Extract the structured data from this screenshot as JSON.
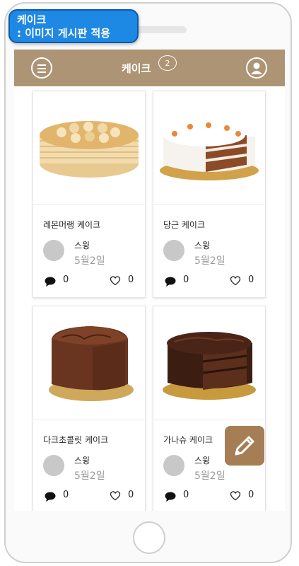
{
  "callout": {
    "line1": "케이크",
    "line2": ": 이미지 게시판 적용"
  },
  "header": {
    "title": "케이크",
    "badge": "2"
  },
  "posts": [
    {
      "title": "레몬머랭 케이크",
      "author": "스윙",
      "date": "5월2일",
      "comments": "0",
      "likes": "0"
    },
    {
      "title": "당근 케이크",
      "author": "스윙",
      "date": "5월2일",
      "comments": "0",
      "likes": "0"
    },
    {
      "title": "다크초콜릿 케이크",
      "author": "스윙",
      "date": "5월2일",
      "comments": "0",
      "likes": "0"
    },
    {
      "title": "가나슈 케이크",
      "author": "스윙",
      "date": "5월2일",
      "comments": "0",
      "likes": "0"
    }
  ],
  "icons": {
    "menu": "hamburger-icon",
    "profile": "user-icon",
    "comment": "speech-bubble-icon",
    "like": "heart-icon",
    "write": "pencil-icon"
  },
  "colors": {
    "header": "#ad9475",
    "fab": "#a57e55",
    "callout": "#1e88e5"
  }
}
